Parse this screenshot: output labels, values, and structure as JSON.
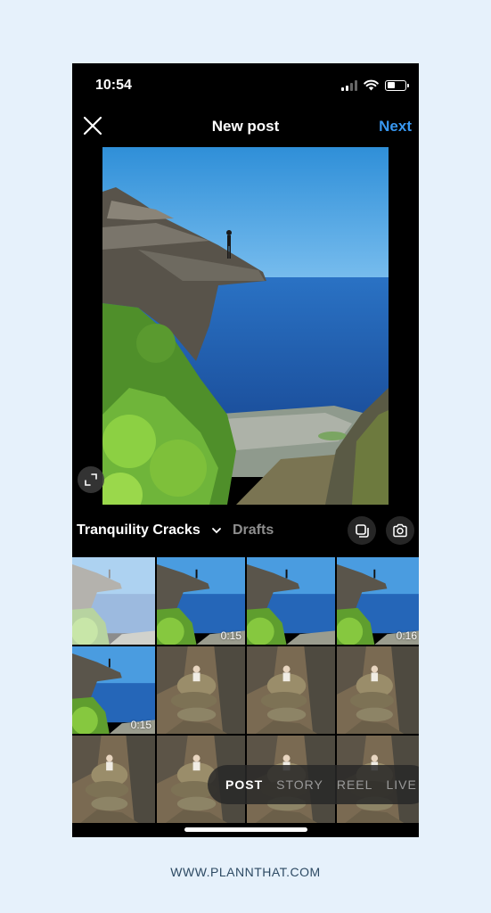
{
  "status_bar": {
    "time": "10:54",
    "battery_level": 0.45
  },
  "header": {
    "title": "New post",
    "next_label": "Next"
  },
  "album": {
    "name": "Tranquility Cracks",
    "drafts_label": "Drafts"
  },
  "grid": {
    "cells": [
      {
        "scene": "cliff",
        "duration": "",
        "selected": true
      },
      {
        "scene": "cliff",
        "duration": "0:15",
        "selected": false
      },
      {
        "scene": "cliff",
        "duration": "",
        "selected": false
      },
      {
        "scene": "cliff",
        "duration": "0:16",
        "selected": false
      },
      {
        "scene": "cliff",
        "duration": "0:15",
        "selected": false
      },
      {
        "scene": "rocks",
        "duration": "",
        "selected": false
      },
      {
        "scene": "rocks",
        "duration": "",
        "selected": false
      },
      {
        "scene": "rocks",
        "duration": "",
        "selected": false
      },
      {
        "scene": "rocks",
        "duration": "",
        "selected": false
      },
      {
        "scene": "rocks",
        "duration": "",
        "selected": false
      },
      {
        "scene": "rocks",
        "duration": "",
        "selected": false
      },
      {
        "scene": "rocks",
        "duration": "",
        "selected": false
      }
    ]
  },
  "modes": {
    "items": [
      {
        "label": "POST",
        "active": true
      },
      {
        "label": "STORY",
        "active": false
      },
      {
        "label": "REEL",
        "active": false
      },
      {
        "label": "LIVE",
        "active": false
      }
    ]
  },
  "colors": {
    "accent": "#3897f0",
    "page_background": "#e6f1fb"
  },
  "footer": {
    "text": "WWW.PLANNTHAT.COM"
  }
}
